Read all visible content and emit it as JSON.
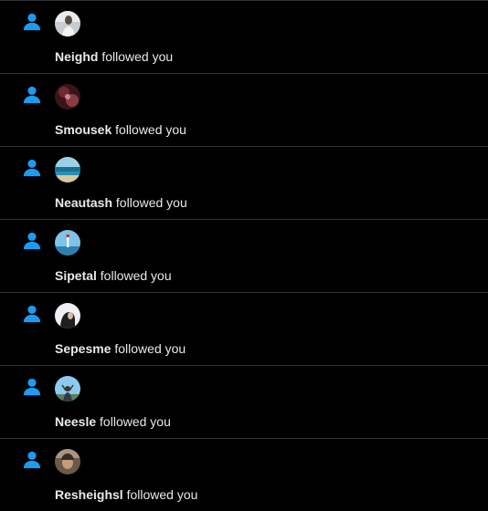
{
  "colors": {
    "accent": "#1d9bf0",
    "background": "#000000",
    "divider": "#2f3336",
    "text": "#e7e9ea"
  },
  "notifications": [
    {
      "icon": "person-icon",
      "user": "Neighd",
      "action": "followed you",
      "avatar": "avatar-portrait-light"
    },
    {
      "icon": "person-icon",
      "user": "Smousek",
      "action": "followed you",
      "avatar": "avatar-dark-red"
    },
    {
      "icon": "person-icon",
      "user": "Neautash",
      "action": "followed you",
      "avatar": "avatar-sea"
    },
    {
      "icon": "person-icon",
      "user": "Sipetal",
      "action": "followed you",
      "avatar": "avatar-lighthouse"
    },
    {
      "icon": "person-icon",
      "user": "Sepesme",
      "action": "followed you",
      "avatar": "avatar-woman-profile"
    },
    {
      "icon": "person-icon",
      "user": "Neesle",
      "action": "followed you",
      "avatar": "avatar-sky-person"
    },
    {
      "icon": "person-icon",
      "user": "Resheighsl",
      "action": "followed you",
      "avatar": "avatar-selfie"
    }
  ]
}
